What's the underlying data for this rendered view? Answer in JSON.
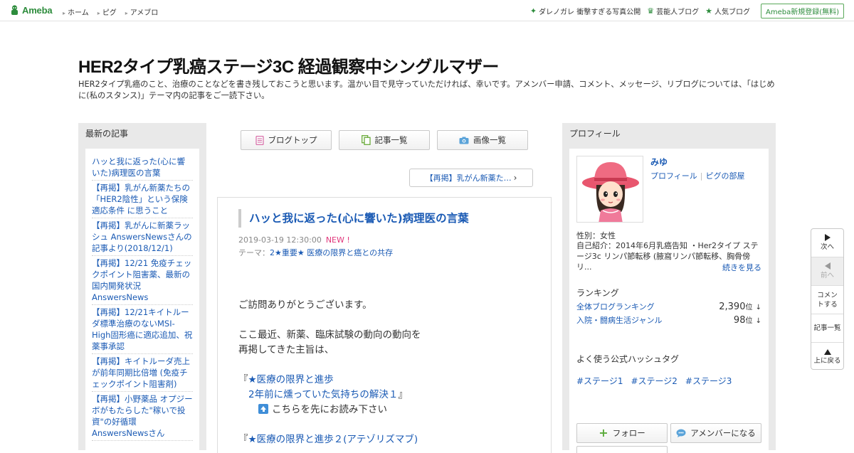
{
  "header": {
    "logo_text": "Ameba",
    "nav": [
      "ホーム",
      "ピグ",
      "アメブロ"
    ],
    "right_links": [
      {
        "icon": "sparkle-icon",
        "label": "ダレノガレ 衝撃すぎる写真公開"
      },
      {
        "icon": "crown-icon",
        "label": "芸能人ブログ"
      },
      {
        "icon": "star-icon",
        "label": "人気ブログ"
      }
    ],
    "register_label": "Ameba新規登録(無料)"
  },
  "blog": {
    "title": "HER2タイプ乳癌ステージ3C 経過観察中シングルマザー",
    "description": "HER2タイプ乳癌のこと、治療のことなどを書き残しておこうと思います。温かい目で見守っていただければ、幸いです。アメンバー申請、コメント、メッセージ、リブログについては、「はじめに(私のスタンス)」テーマ内の記事をご一読下さい。"
  },
  "left_sidebar": {
    "heading": "最新の記事",
    "recent_articles": [
      "ハッと我に返った(心に響いた)病理医の言葉",
      "【再掲】乳がん新薬たちの「HER2陰性」という保険適応条件 に思うこと",
      "【再掲】乳がんに新薬ラッシュ AnswersNewsさんの記事より(2018/12/1)",
      "【再掲】12/21 免疫チェックポイント阻害薬、最新の国内開発状況 AnswersNews",
      "【再掲】12/21キイトルーダ標準治療のないMSI-High固形癌に適応追加、祝 薬事承認",
      "【再掲】キイトルーダ売上が前年同期比倍増 (免疫チェックポイント阻害剤)",
      "【再掲】小野薬品 オプジーボがもたらした\"稼いで投資\"の好循環 AnswersNewsさん"
    ]
  },
  "blog_nav": {
    "top_label": "ブログトップ",
    "list_label": "記事一覧",
    "images_label": "画像一覧",
    "prev_article_label": "【再掲】乳がん新薬た…"
  },
  "article": {
    "title": "ハッと我に返った(心に響いた)病理医の言葉",
    "date": "2019-03-19 12:30:00",
    "new_badge": "NEW !",
    "theme_prefix": "テーマ：",
    "theme": "2★重要★ 医療の限界と癌との共存",
    "body": {
      "greeting": "ご訪問ありがとうございます。",
      "line1": "ここ最近、新薬、臨床試験の動向の動向を",
      "line2": "再掲してきた主旨は、",
      "quote1_open": "『",
      "quote1_link": "★医療の限界と進歩",
      "quote1_link2": "2年前に燻っていた気持ちの解決１",
      "quote1_close": "』",
      "read_first": "こちらを先にお読み下さい",
      "quote2_open": "『",
      "quote2_link": "★医療の限界と進歩２(アテゾリズマブ)"
    }
  },
  "profile": {
    "heading": "プロフィール",
    "name": "みゆ",
    "profile_link": "プロフィール",
    "pig_link": "ピグの部屋",
    "gender": "性別：女性",
    "intro": "自己紹介：2014年6月乳癌告知 ・Her2タイプ ステージ3c リンパ節転移 (腋窩リンパ節転移、胸骨傍リ...",
    "more_label": "続きを見る",
    "ranking_heading": "ランキング",
    "rankings": [
      {
        "label": "全体ブログランキング",
        "value": "2,390",
        "unit": "位",
        "trend": "↓"
      },
      {
        "label": "入院・闘病生活ジャンル",
        "value": "98",
        "unit": "位",
        "trend": "↓"
      }
    ],
    "hashtag_heading": "よく使う公式ハッシュタグ",
    "hashtags": [
      "#ステージ1",
      "#ステージ2",
      "#ステージ3"
    ],
    "follow_label": "フォロー",
    "amember_label": "アメンバーになる"
  },
  "side_nav": {
    "next": "次へ",
    "prev": "前へ",
    "comment": "コメントする",
    "list": "記事一覧",
    "top": "上に戻る"
  },
  "colors": {
    "brand_green": "#2d8c3c",
    "link_blue": "#1a5ab4",
    "new_pink": "#e0357a"
  }
}
